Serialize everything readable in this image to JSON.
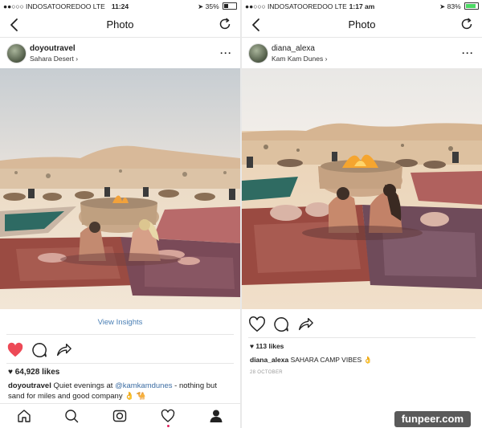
{
  "left": {
    "status": {
      "carrier": "●●○○○ INDOSATOOREDOO  LTE",
      "time": "11:24",
      "battery": "35%",
      "battery_fill": 0.35
    },
    "nav_title": "Photo",
    "post": {
      "username": "doyoutravel",
      "location": "Sahara Desert"
    },
    "view_insights": "View Insights",
    "likes": "64,928 likes",
    "caption": {
      "username": "doyoutravel",
      "text_before": " Quiet evenings at ",
      "mention": "@kamkamdunes",
      "text_after": " - nothing but sand for miles and good company 👌 🐪"
    }
  },
  "right": {
    "status": {
      "carrier": "●●○○○ INDOSATOOREDOO  LTE",
      "time": "1:17 am",
      "battery": "83%",
      "battery_fill": 0.83
    },
    "nav_title": "Photo",
    "post": {
      "username": "diana_alexa",
      "location": "Kam Kam Dunes"
    },
    "likes": "113 likes",
    "caption": {
      "username": "diana_alexa",
      "text": " SAHARA CAMP VIBES 👌"
    },
    "date": "28 OCTOBER"
  },
  "watermark": "funpeer.com",
  "colors": {
    "like_red": "#ed4956",
    "link_blue": "#4a7fb5",
    "battery_green": "#4cd964"
  },
  "icons": {
    "nav": [
      "back-chevron-icon",
      "refresh-icon"
    ],
    "actions": [
      "heart-icon",
      "comment-icon",
      "share-icon"
    ],
    "tabbar": [
      "home-icon",
      "search-icon",
      "camera-icon",
      "activity-heart-icon",
      "profile-icon"
    ]
  }
}
